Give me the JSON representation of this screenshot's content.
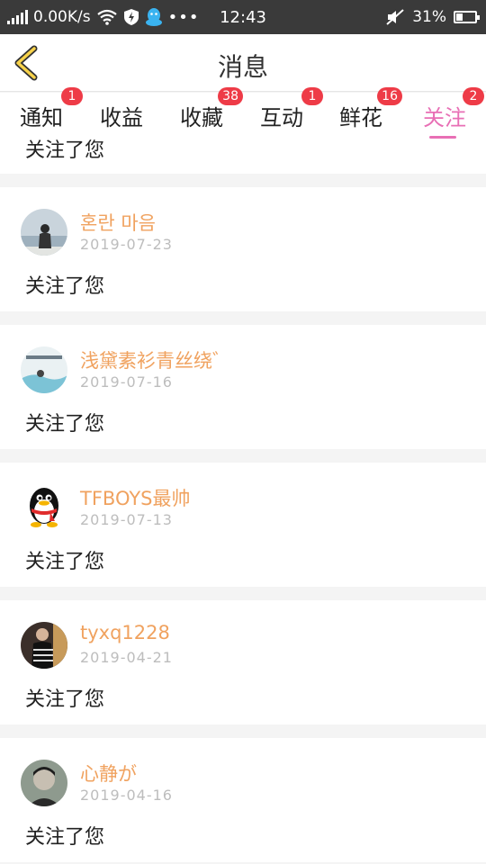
{
  "status_bar": {
    "network_speed": "0.00K/s",
    "time": "12:43",
    "battery": "31%",
    "battery_level": 0.31
  },
  "header": {
    "title": "消息"
  },
  "tabs": [
    {
      "label": "通知",
      "badge": "1"
    },
    {
      "label": "收益",
      "badge": ""
    },
    {
      "label": "收藏",
      "badge": "38"
    },
    {
      "label": "互动",
      "badge": "1"
    },
    {
      "label": "鲜花",
      "badge": "16"
    },
    {
      "label": "关注",
      "badge": "2",
      "active": true
    }
  ],
  "partial_message": "关注了您",
  "items": [
    {
      "name": "혼란 마음",
      "date": "2019-07-23",
      "message": "关注了您"
    },
    {
      "name": "浅黛素衫青丝绕゛",
      "date": "2019-07-16",
      "message": "关注了您"
    },
    {
      "name": "TFBOYS最帅",
      "date": "2019-07-13",
      "message": "关注了您"
    },
    {
      "name": "tyxq1228",
      "date": "2019-04-21",
      "message": "关注了您"
    },
    {
      "name": "心静が",
      "date": "2019-04-16",
      "message": "关注了您"
    }
  ]
}
